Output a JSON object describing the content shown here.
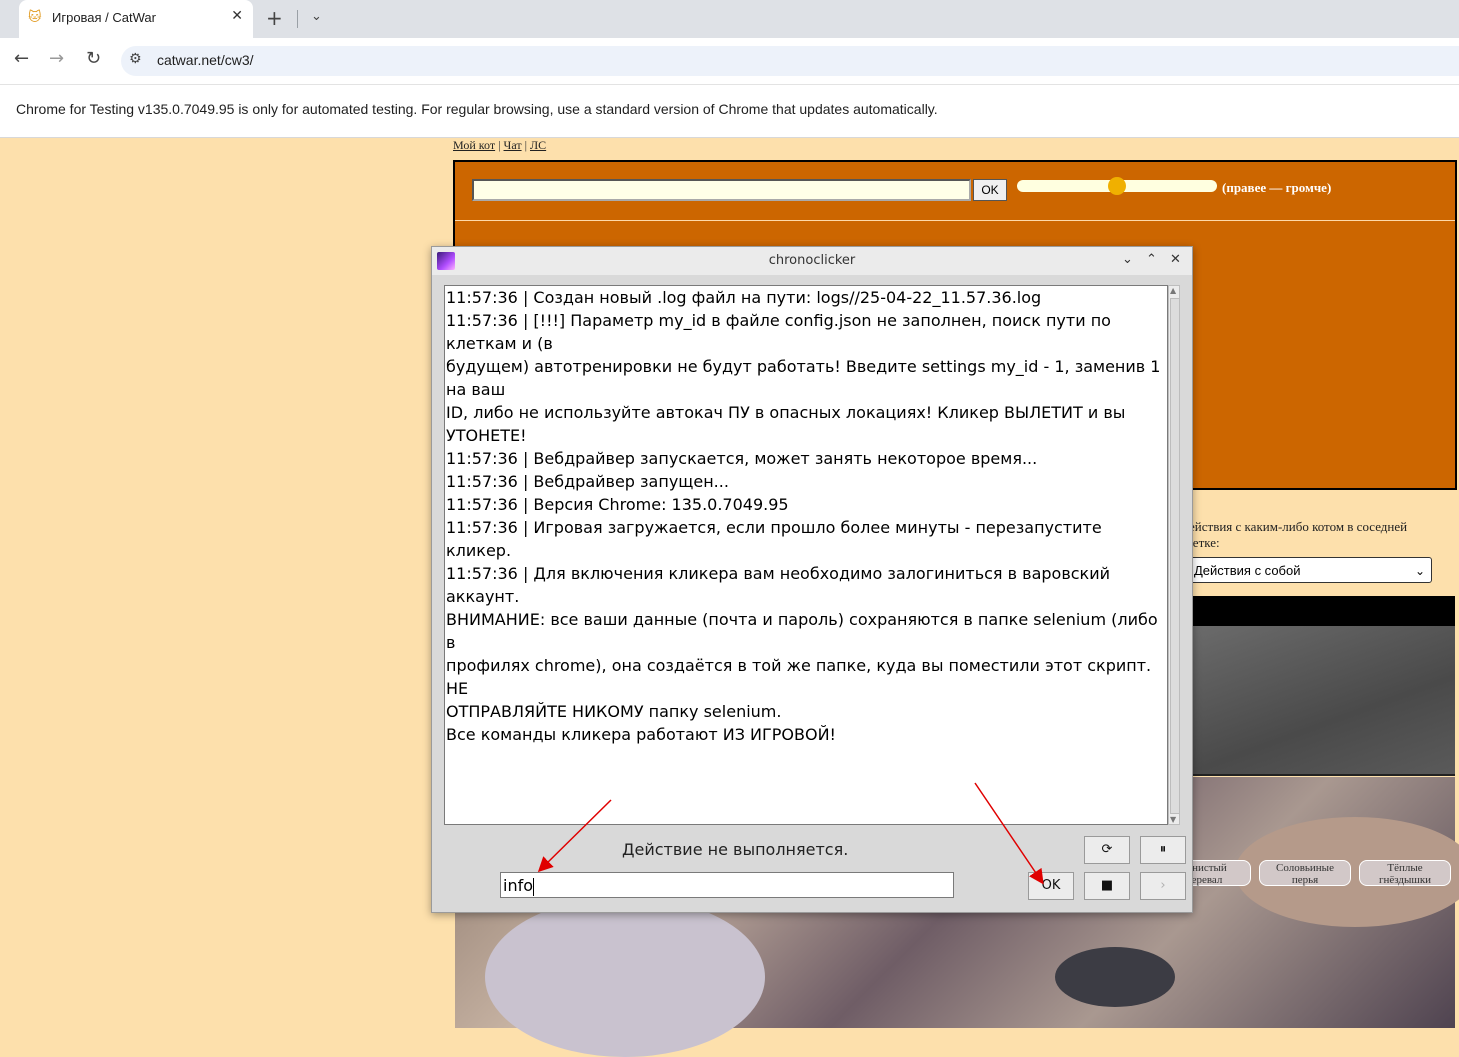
{
  "browser": {
    "tab_title": "Игровая / CatWar",
    "tab_favicon": "cat-icon",
    "url": "catwar.net/cw3/",
    "infobar_text": "Chrome for Testing v135.0.7049.95 is only for automated testing. For regular browsing, use a standard version of Chrome that updates automatically."
  },
  "game": {
    "links": [
      "Мой кот",
      "Чат",
      "ЛС"
    ],
    "chat_ok": "OK",
    "volume_label": "(правее — громче)",
    "volume_level": 0.5,
    "action_label": "Действия с каким-либо котом в соседней клетке:",
    "action_select": "Действия с собой",
    "location_buttons": [
      "Каменистый перевал",
      "Соловьиные перья",
      "Тёплые гнёздышки"
    ],
    "location_buttons_visible": [
      "енистый\nеревал",
      "Соловьиные\nперья",
      "Тёплые\nгнёздышки"
    ],
    "colors": {
      "page_bg": "#fde0ac",
      "chat_bg": "#cc6600"
    }
  },
  "clicker": {
    "window_title": "chronoclicker",
    "log_lines": [
      "11:57:36 | Создан новый .log файл на пути: logs//25-04-22_11.57.36.log",
      "11:57:36 | [!!!] Параметр my_id в файле config.json не заполнен, поиск пути по клеткам и (в",
      "будущем) автотренировки не будут работать! Введите settings my_id - 1, заменив 1 на ваш",
      "ID, либо не используйте автокач ПУ в опасных локациях! Кликер ВЫЛЕТИТ и вы УТОНЕТЕ!",
      "11:57:36 | Вебдрайвер запускается, может занять некоторое время...",
      "11:57:36 | Вебдрайвер запущен...",
      "11:57:36 | Версия Chrome: 135.0.7049.95",
      "11:57:36 | Игровая загружается, если прошло более минуты - перезапустите кликер.",
      "11:57:36 | Для включения кликера вам необходимо залогиниться в варовский аккаунт.",
      "ВНИМАНИЕ: все ваши данные (почта и пароль) сохраняются в папке selenium (либо в",
      "профилях chrome), она создаётся в той же папке, куда вы поместили этот скрипт. НЕ",
      "ОТПРАВЛЯЙТЕ НИКОМУ папку selenium.",
      "Все команды кликера работают ИЗ ИГРОВОЙ!"
    ],
    "status": "Действие не выполняется.",
    "command_value": "info",
    "ok_label": "OK",
    "restart_icon": "⟳",
    "pause_icon": "⏸",
    "stop_icon": "■",
    "next_icon": "›"
  }
}
